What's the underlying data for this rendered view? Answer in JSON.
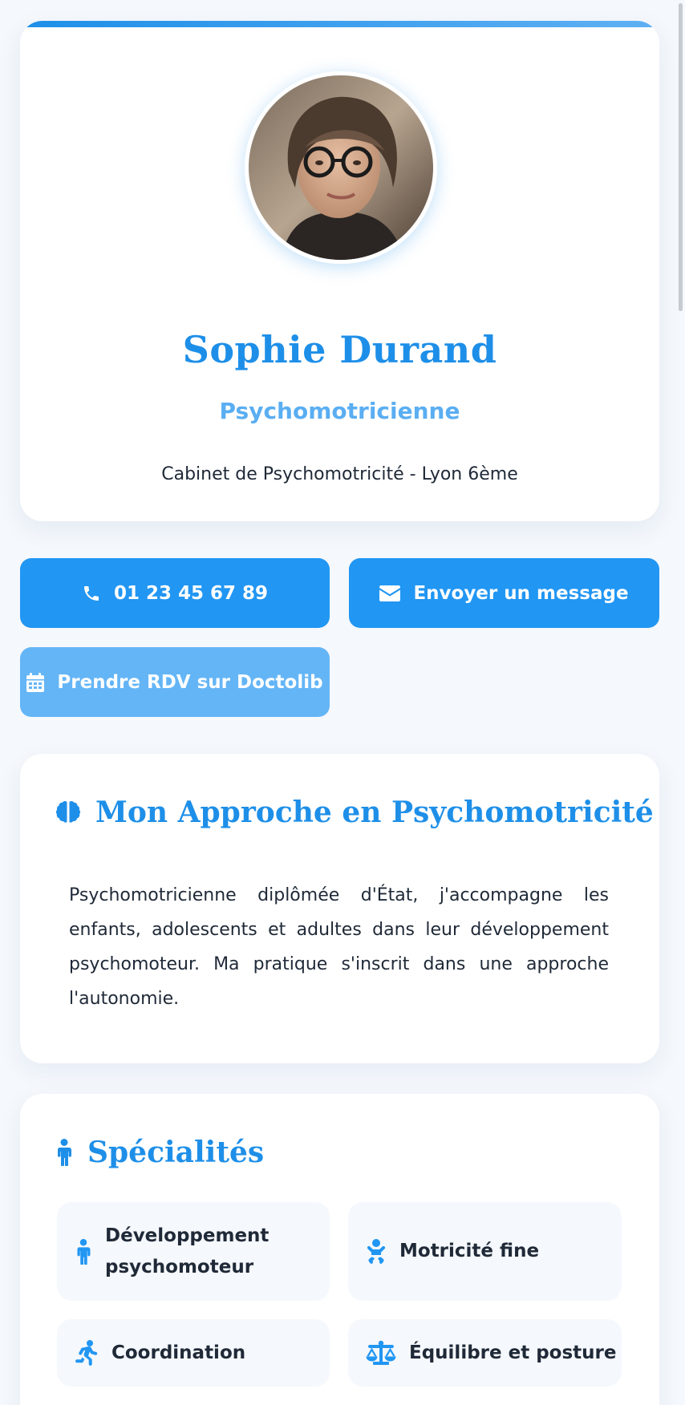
{
  "profile": {
    "name": "Sophie Durand",
    "title": "Psychomotricienne",
    "cabinet": "Cabinet de Psychomotricité - Lyon 6ème"
  },
  "actions": {
    "phone_label": "01 23 45 67 89",
    "message_label": "Envoyer un message",
    "doctolib_label": "Prendre RDV sur Doctolib"
  },
  "approach": {
    "heading": "Mon Approche en Psychomotricité",
    "text": "Psychomotricienne diplômée d'État, j'accompagne les enfants, adolescents et adultes dans leur développement psychomoteur. Ma pratique s'inscrit dans une approche l'autonomie."
  },
  "specialties": {
    "heading": "Spécialités",
    "items": [
      {
        "label": "Développement psychomoteur",
        "icon": "child-icon"
      },
      {
        "label": "Motricité fine",
        "icon": "baby-icon"
      },
      {
        "label": "Coordination",
        "icon": "running-icon"
      },
      {
        "label": "Équilibre et posture",
        "icon": "balance-scale-icon"
      }
    ]
  },
  "colors": {
    "accent": "#2196f3",
    "accent_light": "#64b5f6",
    "heading": "#1e8fe8",
    "background": "#f5f8fc"
  }
}
